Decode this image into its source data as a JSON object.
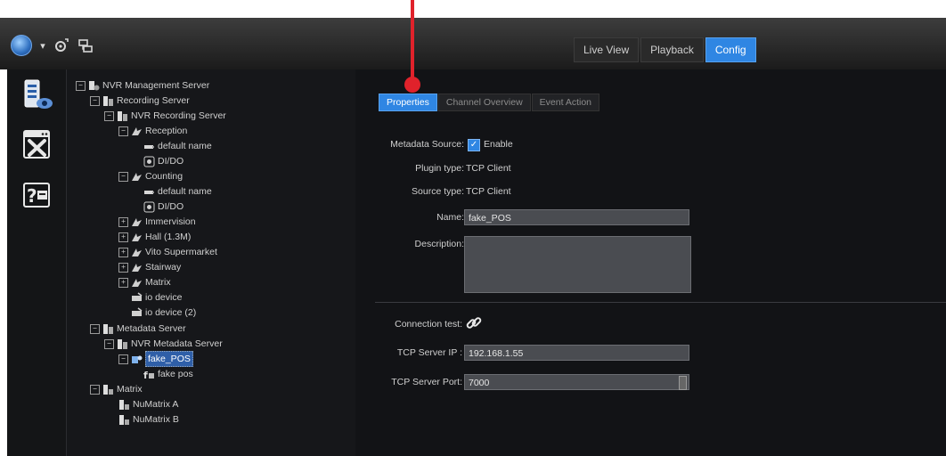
{
  "topbar": {
    "icons": [
      "globe-icon",
      "chevron-down-icon",
      "settings-sync-icon",
      "link-device-icon"
    ],
    "tabs": [
      {
        "label": "Live View",
        "active": false
      },
      {
        "label": "Playback",
        "active": false
      },
      {
        "label": "Config",
        "active": true
      }
    ]
  },
  "sidebar": {
    "icons": [
      "server-icon",
      "tools-icon",
      "help-icon"
    ]
  },
  "tree": {
    "nodes": [
      {
        "label": "NVR Management Server",
        "expander": "−"
      },
      {
        "label": "Recording Server",
        "expander": "−"
      },
      {
        "label": "NVR Recording Server",
        "expander": "−"
      },
      {
        "label": "Reception",
        "expander": "−"
      },
      {
        "label": "default name",
        "expander": ""
      },
      {
        "label": "DI/DO",
        "expander": ""
      },
      {
        "label": "Counting",
        "expander": "−"
      },
      {
        "label": "default name",
        "expander": ""
      },
      {
        "label": "DI/DO",
        "expander": ""
      },
      {
        "label": "Immervision",
        "expander": "+"
      },
      {
        "label": "Hall (1.3M)",
        "expander": "+"
      },
      {
        "label": "Vito Supermarket",
        "expander": "+"
      },
      {
        "label": "Stairway",
        "expander": "+"
      },
      {
        "label": "Matrix",
        "expander": "+"
      },
      {
        "label": "io device",
        "expander": ""
      },
      {
        "label": "io device (2)",
        "expander": ""
      },
      {
        "label": "Metadata Server",
        "expander": "−"
      },
      {
        "label": "NVR Metadata Server",
        "expander": "−"
      },
      {
        "label": "fake_POS",
        "expander": "−",
        "selected": true
      },
      {
        "label": "fake pos",
        "expander": ""
      },
      {
        "label": "Matrix",
        "expander": "−"
      },
      {
        "label": "NuMatrix A",
        "expander": ""
      },
      {
        "label": "NuMatrix B",
        "expander": ""
      }
    ]
  },
  "content": {
    "tabs": [
      {
        "label": "Properties",
        "active": true
      },
      {
        "label": "Channel Overview",
        "active": false
      },
      {
        "label": "Event Action",
        "active": false
      }
    ],
    "metadata_source_label": "Metadata Source:",
    "enable_label": "Enable",
    "enable_checked": true,
    "plugin_type_label": "Plugin type:",
    "plugin_type_value": "TCP Client",
    "source_type_label": "Source type:",
    "source_type_value": "TCP Client",
    "name_label": "Name:",
    "name_value": "fake_POS",
    "description_label": "Description:",
    "description_value": "",
    "connection_test_label": "Connection test:",
    "tcp_server_ip_label": "TCP Server IP :",
    "tcp_server_ip_value": "192.168.1.55",
    "tcp_server_port_label": "TCP Server Port:",
    "tcp_server_port_value": "7000"
  },
  "colors": {
    "accent": "#2f86e3",
    "pointer": "#e0222b"
  }
}
